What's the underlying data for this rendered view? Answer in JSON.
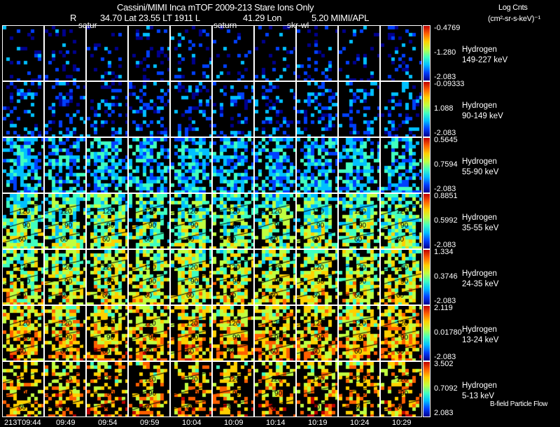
{
  "header": {
    "title": "Cassini/MIMI Inca mTOF  2009-213   Stare   Ions Only",
    "r_label": "R",
    "r_value": "34.70 Lat 23.55 LT 1911 L",
    "l_value": "41.29 Lon",
    "lon_value": "5.20  MIMI/APL"
  },
  "units": {
    "line1": "Log Cnts",
    "line2": "(cm²-sr-s-keV)⁻¹"
  },
  "annotations": [
    "satur",
    "saturn",
    "skr-wl"
  ],
  "footer_note": "B-field Particle Flow",
  "chart_data": {
    "type": "heatmap",
    "title": "Cassini/MIMI Inca mTOF 2009-213 Stare Ions Only",
    "x_ticks": [
      "213T09:44",
      "09:49",
      "09:54",
      "09:59",
      "10:04",
      "10:09",
      "10:14",
      "10:19",
      "10:24",
      "10:29"
    ],
    "contour_levels": [
      "60",
      "90",
      "120"
    ],
    "colormap": [
      "#00008f",
      "#0040ff",
      "#00c0ff",
      "#40ffc0",
      "#c0ff40",
      "#ffd000",
      "#ff6000",
      "#c00000"
    ],
    "rows": [
      {
        "species": "Hydrogen",
        "energy": "149-227 keV",
        "max": "-0.4769",
        "mid": "-1.280",
        "min": "-2.083",
        "density": 0.18,
        "level": 0.15,
        "contours": false
      },
      {
        "species": "Hydrogen",
        "energy": "90-149 keV",
        "max": "-0.09333",
        "mid": "1.088",
        "min": "-2.083",
        "density": 0.35,
        "level": 0.2,
        "contours": false
      },
      {
        "species": "Hydrogen",
        "energy": "55-90 keV",
        "max": "0.5645",
        "mid": "0.7594",
        "min": "-2.083",
        "density": 0.7,
        "level": 0.32,
        "contours": false
      },
      {
        "species": "Hydrogen",
        "energy": "35-55 keV",
        "max": "0.8851",
        "mid": "0.5992",
        "min": "-2.083",
        "density": 0.8,
        "level": 0.48,
        "contours": true
      },
      {
        "species": "Hydrogen",
        "energy": "24-35 keV",
        "max": "1.334",
        "mid": "0.3746",
        "min": "-2.083",
        "density": 0.75,
        "level": 0.58,
        "contours": true
      },
      {
        "species": "Hydrogen",
        "energy": "13-24 keV",
        "max": "2.119",
        "mid": "0.01780",
        "min": "-2.083",
        "density": 0.75,
        "level": 0.68,
        "contours": true
      },
      {
        "species": "Hydrogen",
        "energy": "5-13 keV",
        "max": "3.502",
        "mid": "0.7092",
        "min": "2.083",
        "density": 0.5,
        "level": 0.7,
        "contours": true
      }
    ]
  }
}
